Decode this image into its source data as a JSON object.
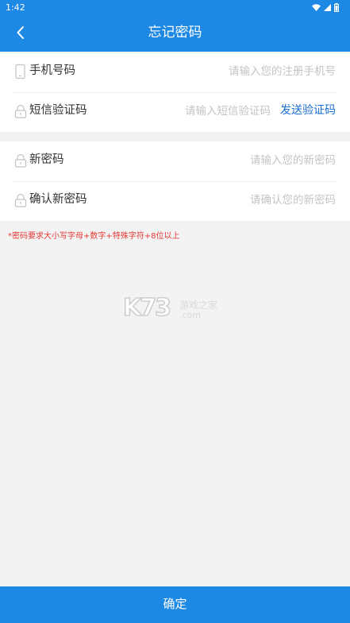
{
  "status_bar": {
    "time": "1:42",
    "icons": [
      "wifi-icon",
      "cell-signal-icon",
      "battery-icon"
    ]
  },
  "header": {
    "title": "忘记密码",
    "back_icon": "chevron-left-icon"
  },
  "form": {
    "phone": {
      "label": "手机号码",
      "placeholder": "请输入您的注册手机号",
      "value": "",
      "icon": "phone-icon"
    },
    "sms": {
      "label": "短信验证码",
      "placeholder": "请输入短信验证码",
      "value": "",
      "icon": "lock-icon",
      "send_label": "发送验证码"
    },
    "new_password": {
      "label": "新密码",
      "placeholder": "请输入您的新密码",
      "value": "",
      "icon": "lock-icon"
    },
    "confirm_password": {
      "label": "确认新密码",
      "placeholder": "请确认您的新密码",
      "value": "",
      "icon": "lock-icon"
    }
  },
  "hint": "*密码要求大小写字母+数字+特殊字符+8位以上",
  "watermark": {
    "brand": "K73",
    "cn": "游戏之家",
    "domain": ".com"
  },
  "submit": {
    "label": "确定"
  },
  "colors": {
    "primary": "#1e88e5",
    "link": "#1a6fd1",
    "hint": "#e53935",
    "background": "#f3f3f3"
  }
}
